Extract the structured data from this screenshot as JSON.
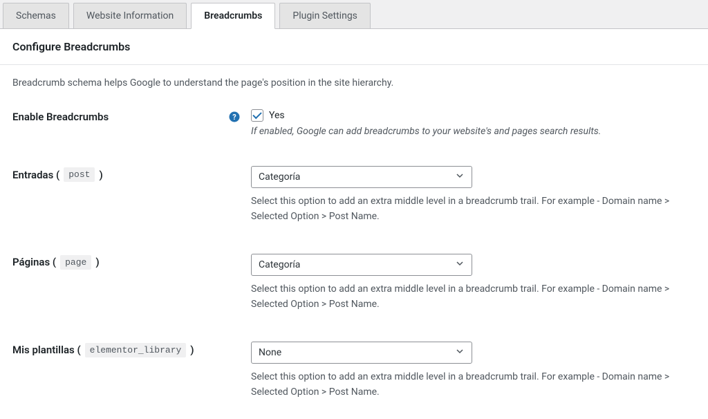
{
  "tabs": {
    "schemas": "Schemas",
    "website_info": "Website Information",
    "breadcrumbs": "Breadcrumbs",
    "plugin_settings": "Plugin Settings"
  },
  "panel": {
    "title": "Configure Breadcrumbs",
    "intro": "Breadcrumb schema helps Google to understand the page's position in the site hierarchy."
  },
  "enable": {
    "label": "Enable Breadcrumbs",
    "checkbox_label": "Yes",
    "help": "If enabled, Google can add breadcrumbs to your website's and pages search results."
  },
  "entradas": {
    "label_pre": "Entradas (",
    "code": "post",
    "label_post": ")",
    "selected": "Categoría",
    "desc": "Select this option to add an extra middle level in a breadcrumb trail. For example - Domain name > Selected Option > Post Name."
  },
  "paginas": {
    "label_pre": "Páginas (",
    "code": "page",
    "label_post": ")",
    "selected": "Categoría",
    "desc": "Select this option to add an extra middle level in a breadcrumb trail. For example - Domain name > Selected Option > Post Name."
  },
  "plantillas": {
    "label_pre": "Mis plantillas (",
    "code": "elementor_library",
    "label_post": ")",
    "selected": "None",
    "desc": "Select this option to add an extra middle level in a breadcrumb trail. For example - Domain name > Selected Option > Post Name."
  }
}
